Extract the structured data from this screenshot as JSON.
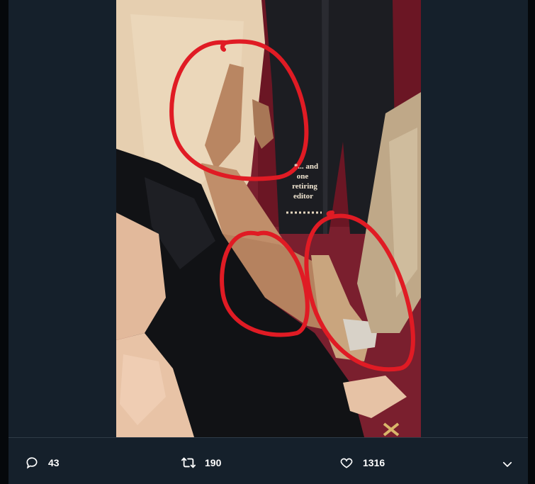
{
  "photo": {
    "overlay_text": [
      "*... and",
      "one",
      "retiring",
      "editor"
    ]
  },
  "actions": {
    "reply_count": "43",
    "retweet_count": "190",
    "like_count": "1316"
  },
  "colors": {
    "background": "#15202b",
    "annotation": "#e01b24",
    "carpet": "#7a1f2e",
    "action_text": "#ffffff"
  },
  "icons": {
    "reply": "reply-icon",
    "retweet": "retweet-icon",
    "like": "heart-icon",
    "more": "chevron-down-icon"
  }
}
